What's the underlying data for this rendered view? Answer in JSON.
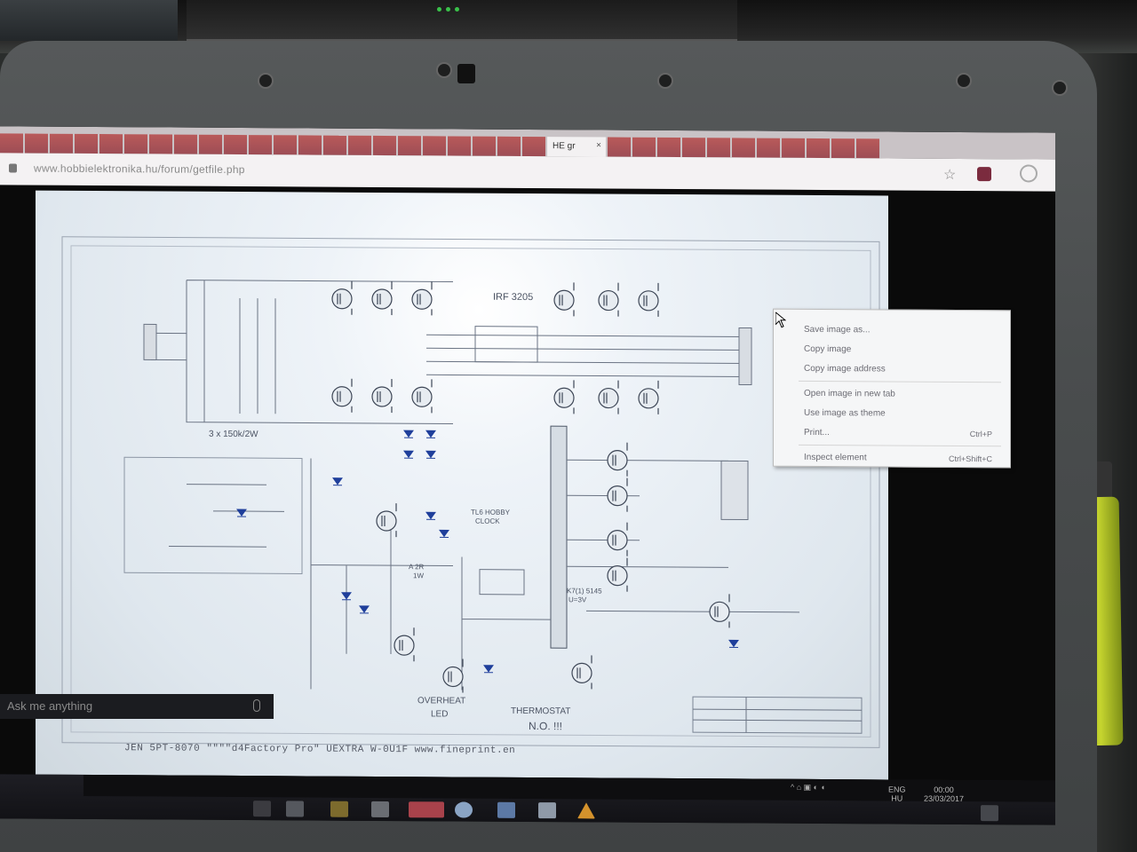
{
  "browser": {
    "active_tab_label": "HE gr",
    "active_tab_close": "×",
    "url": "www.hobbielektronika.hu/forum/getfile.php"
  },
  "schematic_labels": {
    "bank_label_left": "3 x 150k/2W",
    "irf_label": "IRF 3205",
    "overheat_led": "OVERHEAT\nLED",
    "thermostat": "THERMOSTAT\nN.O. !!!",
    "tl_label": "TL6 HOBBY\nCLOCK",
    "k7_label": "K7(1) 5145\nU=3V",
    "a2r": "A 2R\n1W",
    "bottom_overlay": "JEN 5PT-8070 \"\"\"\"d4Factory Pro\" UEXTRA W-0U1F  www.fineprint.en"
  },
  "context_menu": {
    "items": [
      {
        "label": "Save image as...",
        "shortcut": ""
      },
      {
        "label": "Copy image",
        "shortcut": ""
      },
      {
        "label": "Copy image address",
        "shortcut": ""
      },
      {
        "label": "Open image in new tab",
        "shortcut": ""
      },
      {
        "label": "Use image as theme",
        "shortcut": ""
      },
      {
        "label": "Print...",
        "shortcut": "Ctrl+P"
      },
      {
        "label": "Inspect element",
        "shortcut": "Ctrl+Shift+C"
      }
    ]
  },
  "taskbar": {
    "language": "ENG\nHU",
    "time": "00:00\n23/03/2017",
    "search_placeholder": "Ask me anything"
  }
}
